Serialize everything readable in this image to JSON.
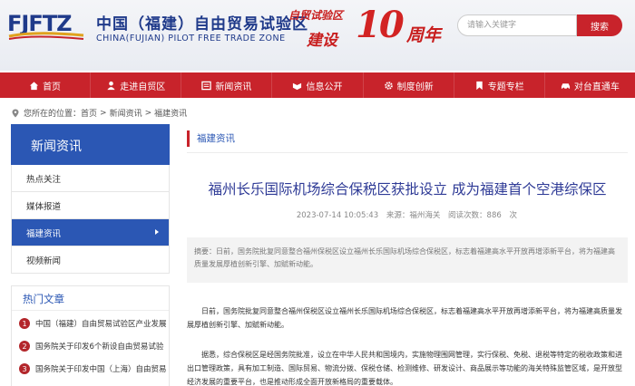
{
  "header": {
    "logo_text": "FJFTZ",
    "site_name_cn": "中国（福建）自由贸易试验区",
    "site_name_en": "CHINA(FUJIAN) PILOT FREE TRADE ZONE",
    "anniversary": {
      "line1": "自贸试验区",
      "line2": "建设",
      "big": "10",
      "suffix": "周年"
    },
    "search": {
      "placeholder": "请输入关键字",
      "button": "搜索"
    }
  },
  "nav": {
    "items": [
      {
        "label": "首页",
        "icon": "home-icon"
      },
      {
        "label": "走进自贸区",
        "icon": "person-icon"
      },
      {
        "label": "新闻资讯",
        "icon": "news-icon"
      },
      {
        "label": "信息公开",
        "icon": "info-icon"
      },
      {
        "label": "制度创新",
        "icon": "gear-icon"
      },
      {
        "label": "专题专栏",
        "icon": "bookmark-icon"
      },
      {
        "label": "对台直通车",
        "icon": "car-icon"
      }
    ]
  },
  "breadcrumb": {
    "prefix": "您所在的位置：",
    "items": [
      "首页",
      "新闻资讯",
      "福建资讯"
    ],
    "separator": ">"
  },
  "sidebar": {
    "title": "新闻资讯",
    "items": [
      {
        "label": "热点关注",
        "active": false
      },
      {
        "label": "媒体报道",
        "active": false
      },
      {
        "label": "福建资讯",
        "active": true
      },
      {
        "label": "视频新闻",
        "active": false
      }
    ],
    "hot_title": "热门文章",
    "hot_items": [
      {
        "num": "1",
        "text": "中国（福建）自由贸易试验区产业发展"
      },
      {
        "num": "2",
        "text": "国务院关于印发6个新设自由贸易试验"
      },
      {
        "num": "3",
        "text": "国务院关于印发中国（上海）自由贸易"
      }
    ]
  },
  "main": {
    "tab": "福建资讯",
    "title": "福州长乐国际机场综合保税区获批设立 成为福建首个空港综保区",
    "meta": {
      "datetime": "2023-07-14 10:05:43",
      "source": "来源：福州海关",
      "views": "阅读次数：886",
      "unit": "次"
    },
    "summary": "摘要：日前，国务院批复同意整合福州保税区设立福州长乐国际机场综合保税区，标志着福建高水平开放再增添新平台，将为福建高质量发展厚植创新引擎、加赋新动能。",
    "paragraphs": [
      "日前，国务院批复同意整合福州保税区设立福州长乐国际机场综合保税区，标志着福建高水平开放再增添新平台，将为福建高质量发展厚植创新引擎、加赋新动能。",
      "据悉，综合保税区是经国务院批准，设立在中华人民共和国境内，实施物理围网管理，实行保税、免税、退税等特定的税收政策和进出口管理政策，具有加工制造、国际贸易、物流分拨、保税仓储、检测维修、研发设计、商品展示等功能的海关特殊监管区域，是开放型经济发展的重要平台，也是推动形成全面开放新格局的重要载体。"
    ]
  },
  "colors": {
    "brand_red": "#c8232b",
    "brand_blue": "#2b57b4",
    "title_blue": "#2e3a96"
  }
}
